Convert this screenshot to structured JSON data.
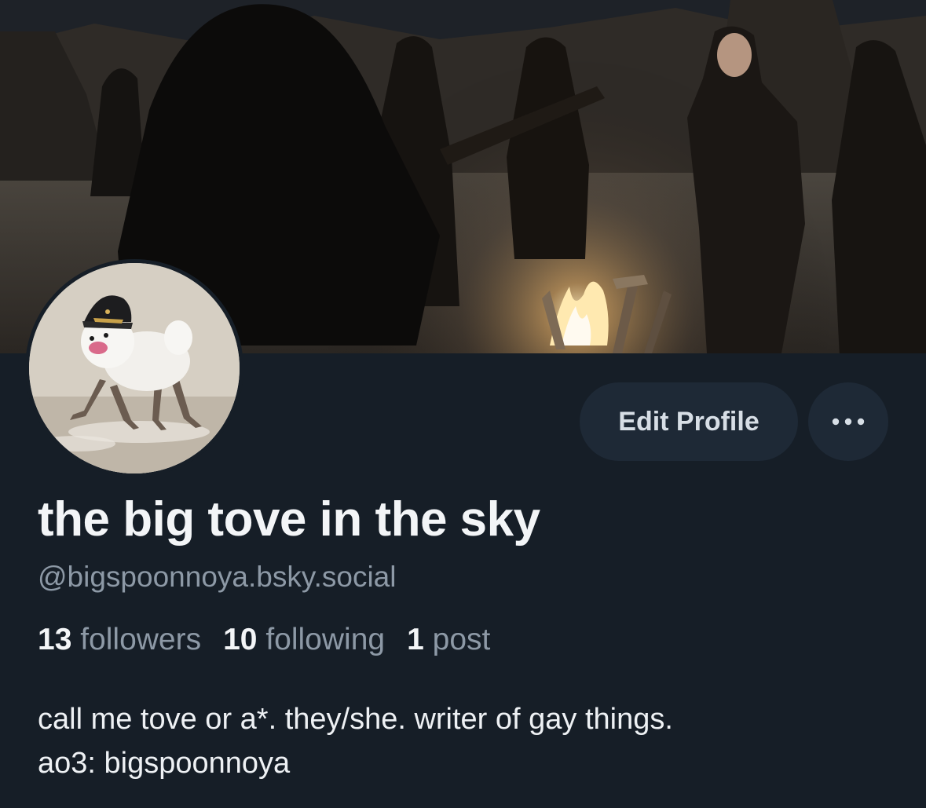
{
  "profile": {
    "display_name": "the big tove in the sky",
    "handle": "@bigspoonnoya.bsky.social",
    "bio_lines": [
      "call me tove or a*. they/she. writer of gay things.",
      "ao3: bigspoonnoya"
    ]
  },
  "actions": {
    "edit_profile_label": "Edit Profile",
    "more_icon": "ellipsis-icon"
  },
  "stats": {
    "followers": {
      "count": "13",
      "label": "followers"
    },
    "following": {
      "count": "10",
      "label": "following"
    },
    "posts": {
      "count": "1",
      "label": "post"
    }
  },
  "colors": {
    "background": "#161e27",
    "button_bg": "#1e2936",
    "muted_text": "#8d99a6",
    "primary_text": "#f3f5f7"
  }
}
